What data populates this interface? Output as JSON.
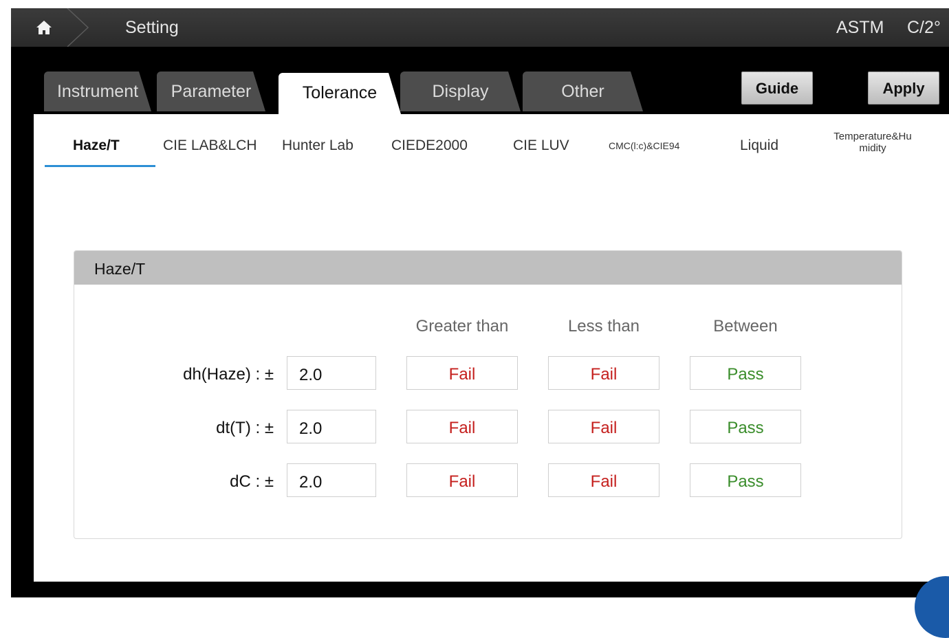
{
  "topbar": {
    "title": "Setting",
    "standard": "ASTM",
    "observer": "C/2°"
  },
  "tabs": [
    {
      "label": "Instrument"
    },
    {
      "label": "Parameter"
    },
    {
      "label": "Tolerance"
    },
    {
      "label": "Display"
    },
    {
      "label": "Other"
    }
  ],
  "actions": {
    "guide_label": "Guide",
    "apply_label": "Apply"
  },
  "subtabs": [
    {
      "label": "Haze/T"
    },
    {
      "label": "CIE LAB&LCH"
    },
    {
      "label": "Hunter Lab"
    },
    {
      "label": "CIEDE2000"
    },
    {
      "label": "CIE LUV"
    },
    {
      "label": "CMC(l:c)&CIE94"
    },
    {
      "label": "Liquid"
    },
    {
      "label": "Temperature&Hu midity"
    }
  ],
  "panel": {
    "title": "Haze/T",
    "columns": [
      "Greater than",
      "Less than",
      "Between"
    ],
    "rows": [
      {
        "label": "dh(Haze) : ±",
        "value": "2.0",
        "greater": "Fail",
        "less": "Fail",
        "between": "Pass"
      },
      {
        "label": "dt(T) : ±",
        "value": "2.0",
        "greater": "Fail",
        "less": "Fail",
        "between": "Pass"
      },
      {
        "label": "dC : ±",
        "value": "2.0",
        "greater": "Fail",
        "less": "Fail",
        "between": "Pass"
      }
    ]
  },
  "colors": {
    "fail": "#c5201e",
    "pass": "#3a8d2b",
    "accent": "#2d8fd5"
  }
}
